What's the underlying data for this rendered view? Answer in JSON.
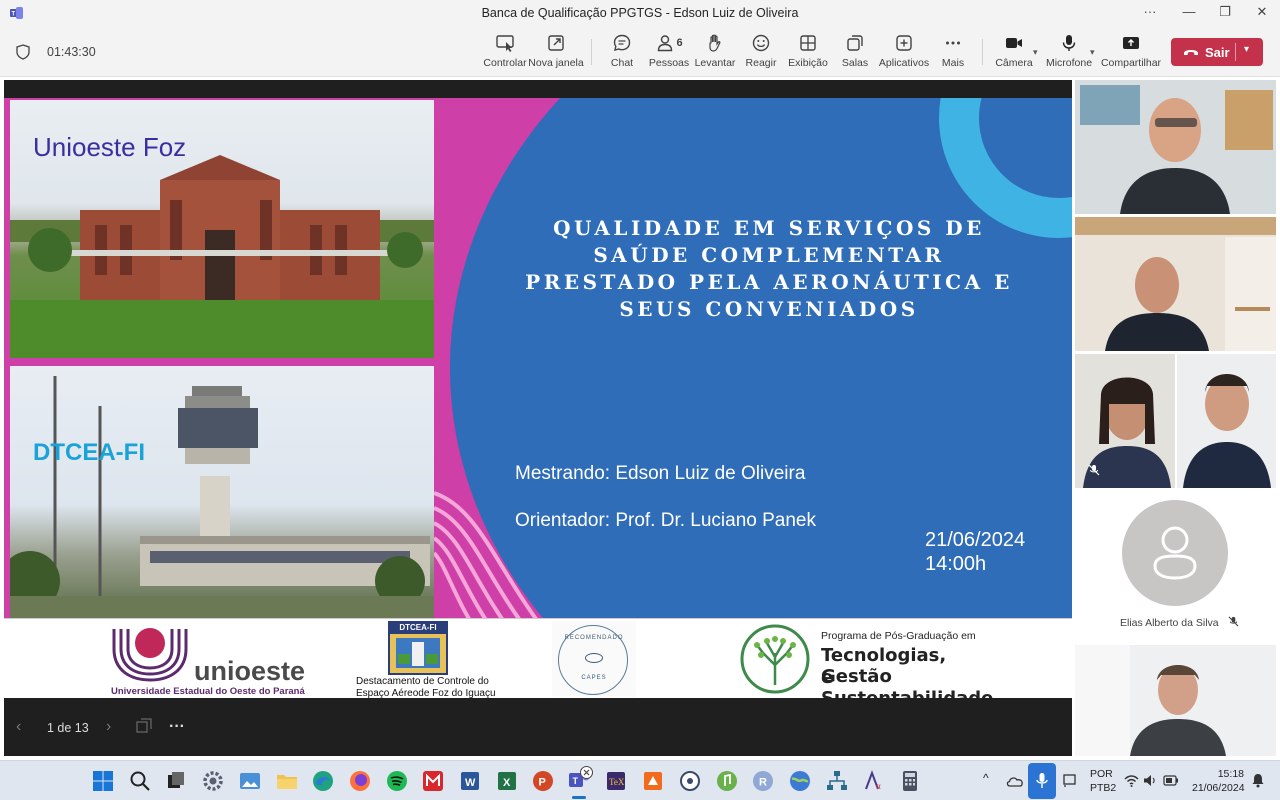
{
  "window": {
    "title": "Banca de Qualificação PPGTGS - Edson Luiz de Oliveira",
    "more": "···",
    "minimize": "—",
    "maximize": "❐",
    "close": "✕"
  },
  "toolbar": {
    "timer": "01:43:30",
    "controlar": "Controlar",
    "nova_janela": "Nova janela",
    "chat": "Chat",
    "pessoas": "Pessoas",
    "pessoas_count": "6",
    "levantar": "Levantar",
    "reagir": "Reagir",
    "exibicao": "Exibição",
    "salas": "Salas",
    "aplicativos": "Aplicativos",
    "mais": "Mais",
    "camera": "Câmera",
    "microfone": "Microfone",
    "compartilhar": "Compartilhar",
    "sair": "Sair"
  },
  "slide": {
    "photo1_label": "Unioeste Foz",
    "photo2_label": "DTCEA-FI",
    "title_lines": [
      "QUALIDADE EM SERVIÇOS DE",
      "SAÚDE COMPLEMENTAR",
      "PRESTADO PELA AERONÁUTICA E",
      "SEUS CONVENIADOS"
    ],
    "mestrando": "Mestrando: Edson Luiz de Oliveira",
    "orientador": "Orientador: Prof. Dr. Luciano Panek",
    "date": "21/06/2024",
    "time": "14:00h",
    "logos": {
      "unioeste_name": "unioeste",
      "unioeste_sub": "Universidade Estadual do Oeste do Paraná",
      "dtcea_badge": "DTCEA-FI",
      "dtcea_line1": "Destacamento de Controle do",
      "dtcea_line2": "Espaço Aéreode Foz do Iguaçu",
      "capes_top": "RECOMENDADO",
      "capes_bottom": "CAPES",
      "ppg_line1": "Programa de Pós-Graduação em",
      "ppg_line2": "Tecnologias, Gestão",
      "ppg_line3": "e Sustentabilidade"
    }
  },
  "presenter": {
    "page": "1 de 13",
    "more": "···"
  },
  "participants": {
    "avatar_name": "Elias Alberto da Silva"
  },
  "taskbar": {
    "lang1": "POR",
    "lang2": "PTB2",
    "clock_time": "15:18",
    "clock_date": "21/06/2024"
  }
}
